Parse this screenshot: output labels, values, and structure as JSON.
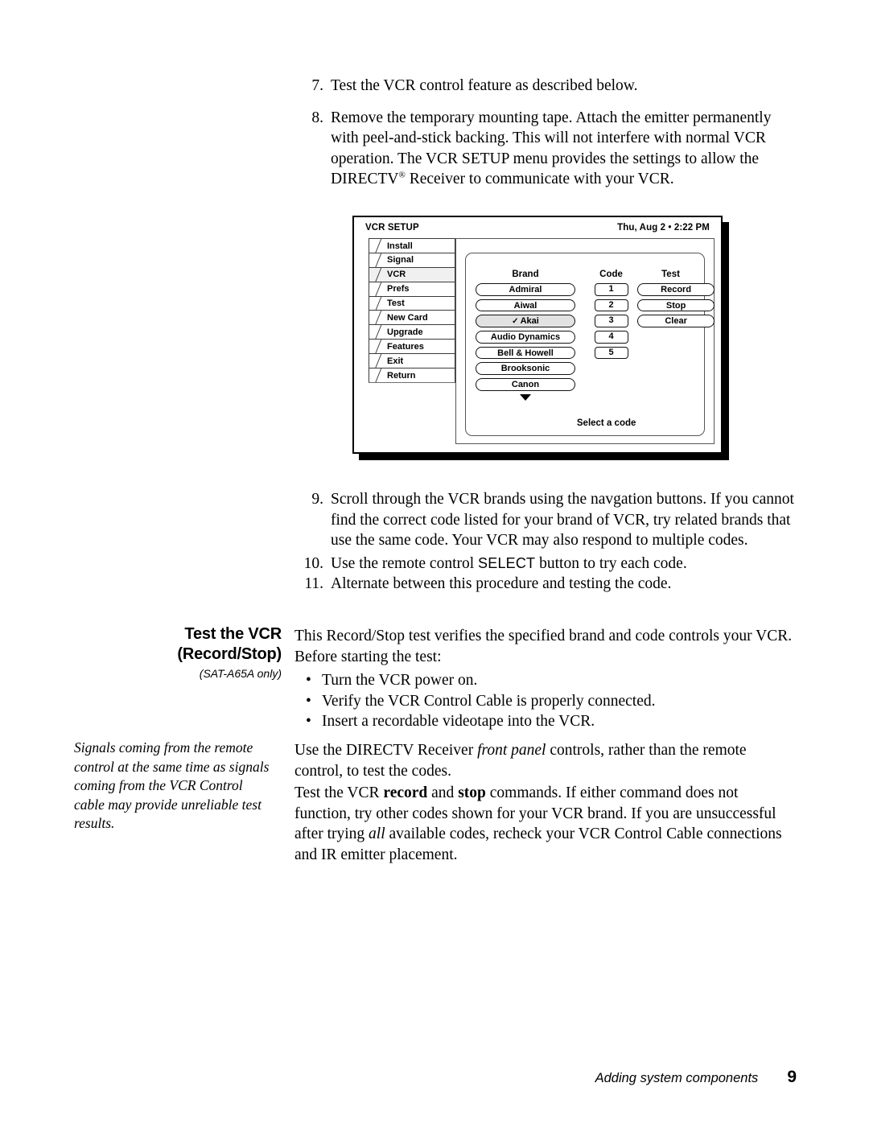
{
  "steps_top": [
    {
      "num": "7.",
      "text": "Test the VCR control feature as described below."
    },
    {
      "num": "8.",
      "text_a": "Remove the temporary mounting tape. Attach the emitter permanently with peel-and-stick backing. This will not interfere with normal VCR operation. The VCR SETUP menu provides the settings to allow the DIRECTV",
      "reg": "®",
      "text_b": " Receiver to communicate with your VCR."
    }
  ],
  "figure": {
    "title": "VCR SETUP",
    "datetime": "Thu, Aug 2 • 2:22 PM",
    "tabs": [
      {
        "label": "Install",
        "selected": false
      },
      {
        "label": "Signal",
        "selected": false
      },
      {
        "label": "VCR",
        "selected": true
      },
      {
        "label": "Prefs",
        "selected": false
      },
      {
        "label": "Test",
        "selected": false
      },
      {
        "label": "New Card",
        "selected": false
      },
      {
        "label": "Upgrade",
        "selected": false
      },
      {
        "label": "Features",
        "selected": false
      },
      {
        "label": "Exit",
        "selected": false
      },
      {
        "label": "Return",
        "selected": false
      }
    ],
    "columns": {
      "brand_header": "Brand",
      "code_header": "Code",
      "test_header": "Test"
    },
    "brands": [
      {
        "label": "Admiral",
        "selected": false
      },
      {
        "label": "Aiwal",
        "selected": false
      },
      {
        "label": "Akai",
        "selected": true,
        "check": "✓"
      },
      {
        "label": "Audio Dynamics",
        "selected": false
      },
      {
        "label": "Bell & Howell",
        "selected": false
      },
      {
        "label": "Brooksonic",
        "selected": false
      },
      {
        "label": "Canon",
        "selected": false
      }
    ],
    "codes": [
      "1",
      "2",
      "3",
      "4",
      "5"
    ],
    "test_buttons": [
      "Record",
      "Stop",
      "Clear"
    ],
    "status": "Select a code"
  },
  "steps_mid": [
    {
      "num": "9.",
      "text": "Scroll through the VCR brands using the navgation buttons. If you cannot find the correct code listed for your brand of VCR, try related brands that use the same code. Your VCR may also respond to multiple codes."
    },
    {
      "num": "10.",
      "text_a": "Use the remote control ",
      "sc": "SELECT",
      "text_b": " button to try each code."
    },
    {
      "num": "11.",
      "text": "Alternate between this procedure and testing the code."
    }
  ],
  "side": {
    "heading_line1": "Test the VCR",
    "heading_line2": "(Record/Stop)",
    "subtitle": "(SAT-A65A only)",
    "note": "Signals coming from the remote control at the same time as signals coming from the VCR Control cable may provide unreliable test results."
  },
  "body": {
    "p1": "This Record/Stop test verifies the specified brand and code controls your VCR. Before starting the test:",
    "bullets": [
      "Turn the VCR power on.",
      "Verify the VCR Control Cable is properly connected.",
      "Insert a recordable videotape into the VCR."
    ],
    "p2_a": "Use the DIRECTV Receiver ",
    "p2_em": "front panel",
    "p2_b": " controls, rather than the remote control, to test the codes.",
    "p3_a": "Test the VCR ",
    "p3_b1": "record",
    "p3_b_mid": " and ",
    "p3_b2": "stop",
    "p3_c": " commands. If either command does not function, try other codes shown for your VCR brand. If you are unsuccessful after trying ",
    "p3_em": "all",
    "p3_d": " available codes, recheck your VCR Control Cable connections and IR emitter placement."
  },
  "footer": {
    "text": "Adding system components",
    "page": "9"
  },
  "colors": {
    "ink": "#000000",
    "paper": "#ffffff",
    "selected_fill": "#e2e2e2",
    "tab_selected_fill": "#f0f0f0",
    "panel_border": "#555555"
  }
}
